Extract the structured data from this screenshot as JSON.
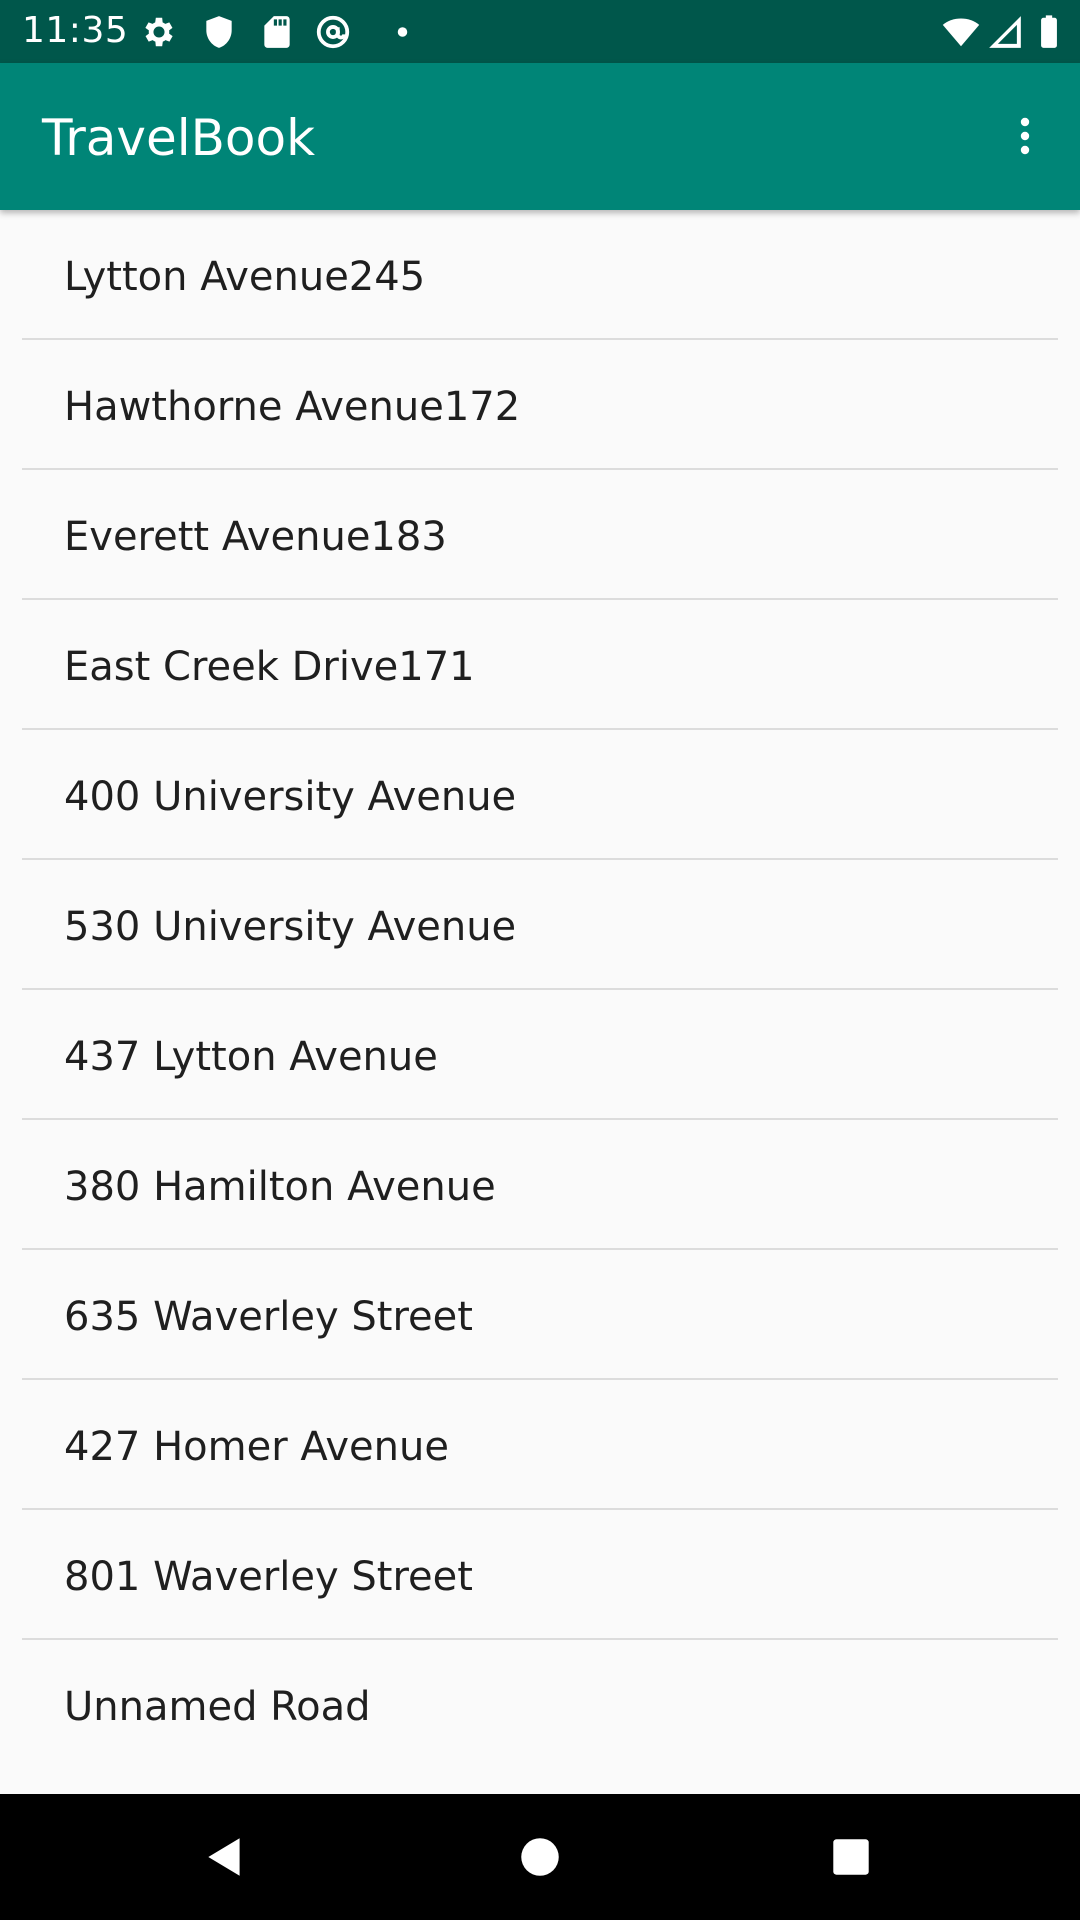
{
  "status_bar": {
    "time": "11:35",
    "left_icons": [
      "gear-icon",
      "shield-icon",
      "sd-card-icon",
      "at-sign-icon",
      "dot-icon"
    ],
    "right_icons": [
      "wifi-icon",
      "cell-signal-icon",
      "battery-icon"
    ],
    "background": "#00574b"
  },
  "app_bar": {
    "title": "TravelBook",
    "background": "#008577",
    "menu_icon": "more-vert-icon"
  },
  "list": {
    "items": [
      {
        "label": "Lytton Avenue245"
      },
      {
        "label": "Hawthorne Avenue172"
      },
      {
        "label": "Everett Avenue183"
      },
      {
        "label": "East Creek Drive171"
      },
      {
        "label": "400 University Avenue"
      },
      {
        "label": "530 University Avenue"
      },
      {
        "label": "437 Lytton Avenue"
      },
      {
        "label": "380 Hamilton Avenue"
      },
      {
        "label": "635 Waverley Street"
      },
      {
        "label": "427 Homer Avenue"
      },
      {
        "label": "801 Waverley Street"
      },
      {
        "label": "Unnamed Road"
      }
    ]
  },
  "nav_bar": {
    "buttons": [
      "back-icon",
      "home-icon",
      "recents-icon"
    ]
  }
}
